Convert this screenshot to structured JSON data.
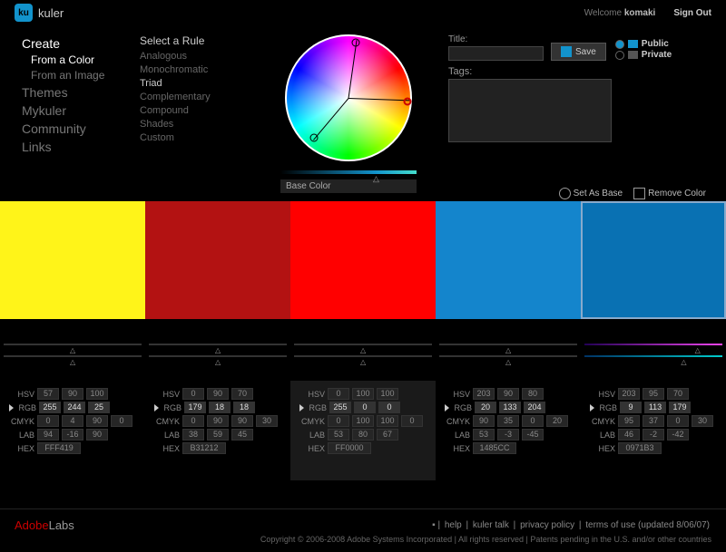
{
  "header": {
    "logo_abbr": "ku",
    "logo_text": "kuler",
    "welcome": "Welcome",
    "username": "komaki",
    "signout": "Sign Out"
  },
  "nav": {
    "create": "Create",
    "from_color": "From a Color",
    "from_image": "From an Image",
    "themes": "Themes",
    "mykuler": "Mykuler",
    "community": "Community",
    "links": "Links"
  },
  "rules": {
    "header": "Select a Rule",
    "items": [
      "Analogous",
      "Monochromatic",
      "Triad",
      "Complementary",
      "Compound",
      "Shades",
      "Custom"
    ],
    "active": 2
  },
  "wheel": {
    "basecolor": "Base Color"
  },
  "form": {
    "title_label": "Title:",
    "title_value": "",
    "save": "Save",
    "tags_label": "Tags:"
  },
  "privacy": {
    "public": "Public",
    "private": "Private"
  },
  "actions": {
    "set_as_base": "Set As Base",
    "remove_color": "Remove Color"
  },
  "swatches": [
    {
      "hex": "#FFF419"
    },
    {
      "hex": "#B31212"
    },
    {
      "hex": "#FF0000"
    },
    {
      "hex": "#1485CC"
    },
    {
      "hex": "#0971B3"
    }
  ],
  "selected_swatch": 4,
  "colorspaces": [
    "HSV",
    "RGB",
    "CMYK",
    "LAB",
    "HEX"
  ],
  "values": [
    {
      "hsv": [
        "57",
        "90",
        "100"
      ],
      "rgb": [
        "255",
        "244",
        "25"
      ],
      "cmyk": [
        "0",
        "4",
        "90",
        "0"
      ],
      "lab": [
        "94",
        "-16",
        "90"
      ],
      "hex": "FFF419"
    },
    {
      "hsv": [
        "0",
        "90",
        "70"
      ],
      "rgb": [
        "179",
        "18",
        "18"
      ],
      "cmyk": [
        "0",
        "90",
        "90",
        "30"
      ],
      "lab": [
        "38",
        "59",
        "45"
      ],
      "hex": "B31212"
    },
    {
      "hsv": [
        "0",
        "100",
        "100"
      ],
      "rgb": [
        "255",
        "0",
        "0"
      ],
      "cmyk": [
        "0",
        "100",
        "100",
        "0"
      ],
      "lab": [
        "53",
        "80",
        "67"
      ],
      "hex": "FF0000"
    },
    {
      "hsv": [
        "203",
        "90",
        "80"
      ],
      "rgb": [
        "20",
        "133",
        "204"
      ],
      "cmyk": [
        "90",
        "35",
        "0",
        "20"
      ],
      "lab": [
        "53",
        "-3",
        "-45"
      ],
      "hex": "1485CC"
    },
    {
      "hsv": [
        "203",
        "95",
        "70"
      ],
      "rgb": [
        "9",
        "113",
        "179"
      ],
      "cmyk": [
        "95",
        "37",
        "0",
        "30"
      ],
      "lab": [
        "46",
        "-2",
        "-42"
      ],
      "hex": "0971B3"
    }
  ],
  "footer": {
    "adobe": "Adobe",
    "labs": "Labs",
    "links": [
      "help",
      "kuler talk",
      "privacy policy",
      "terms of use (updated 8/06/07)"
    ],
    "copyright": "Copyright © 2006-2008 Adobe Systems Incorporated | All rights reserved | Patents pending in the U.S. and/or other countries"
  }
}
